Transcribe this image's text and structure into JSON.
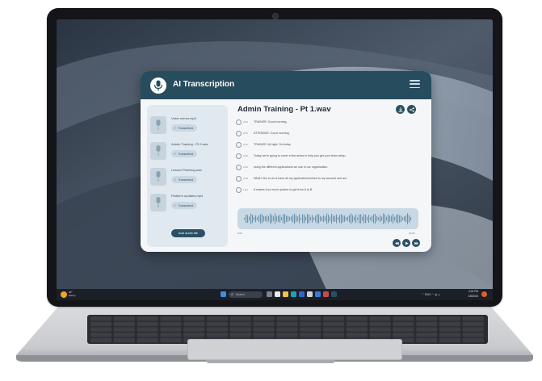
{
  "app": {
    "title": "AI Transcription",
    "files": [
      {
        "name": "Voice memo.mp3",
        "status": "Transcribed"
      },
      {
        "name": "Admin Training - Pt 2.wav",
        "status": "Transcribed"
      },
      {
        "name": "Lesson Planning.wav",
        "status": "Transcribed"
      },
      {
        "name": "Platform updates.mp4",
        "status": "Transcribed"
      }
    ],
    "add_button": "Add audio file",
    "main_title": "Admin Training - Pt 1.wav",
    "transcript": [
      {
        "time": "0:00",
        "text": "TRAINER: Good morning."
      },
      {
        "time": "0:05",
        "text": "ATTENDEE: Good morning."
      },
      {
        "time": "0:12",
        "text": "TRAINER: All right. So today"
      },
      {
        "time": "0:20",
        "text": "Today we're going to cover a few areas to help you get your team setup"
      },
      {
        "time": "0:34",
        "text": "using the different applications we use in our organization"
      },
      {
        "time": "0:48",
        "text": "What I like to do is have all my applications linked to my account and are"
      },
      {
        "time": "1:02",
        "text": "It makes it so much quicker to get from A to B"
      }
    ],
    "time_start": "0:00",
    "time_end": "00:35"
  },
  "taskbar": {
    "weather_temp": "20°",
    "weather_desc": "Sunny",
    "search_placeholder": "Search",
    "tray": "ENG",
    "time": "2:02 PM",
    "date": "1/5/2024"
  },
  "colors": {
    "header": "#274c5e",
    "accent": "#2c4f63",
    "sidebar": "#e1e9f0",
    "waveform": "#6b93ab"
  }
}
